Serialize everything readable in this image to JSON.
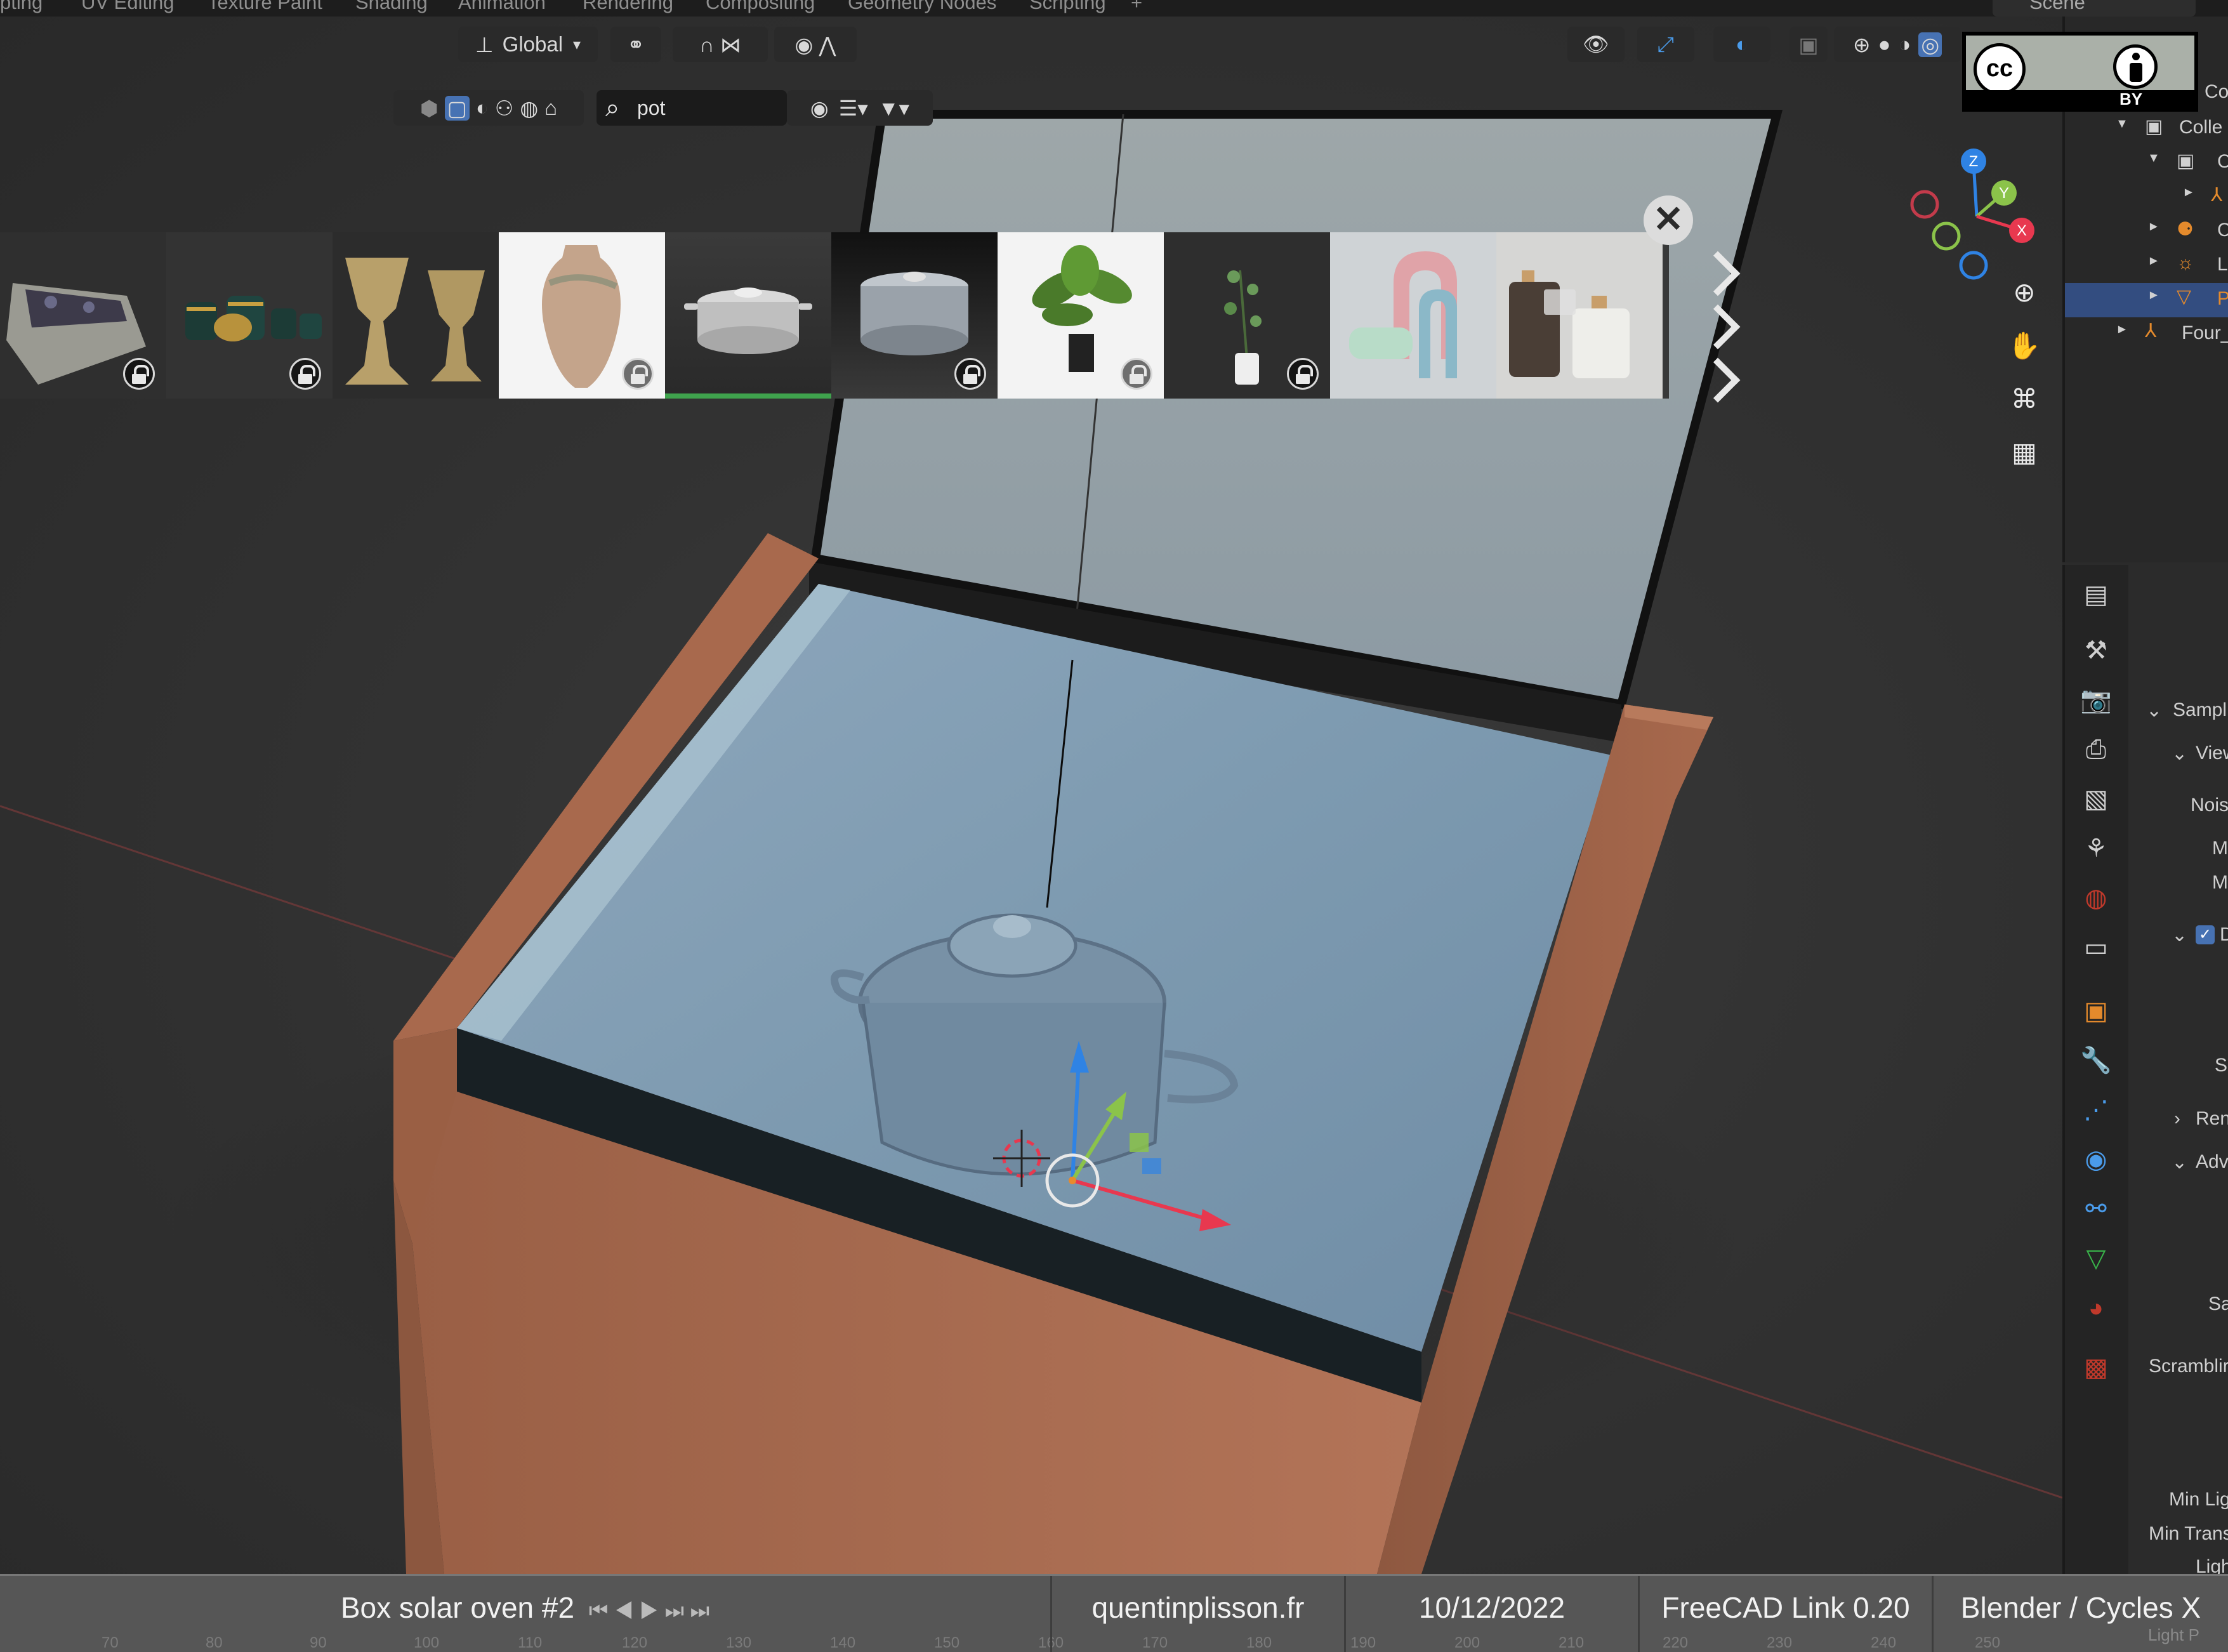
{
  "workspace_tabs": [
    "pting",
    "UV Editing",
    "Texture Paint",
    "Shading",
    "Animation",
    "Rendering",
    "Compositing",
    "Geometry Nodes",
    "Scripting",
    "+"
  ],
  "scene_name": "Scene",
  "viewport_header": {
    "transform_orientation": "Global",
    "search_value": "pot"
  },
  "asset_browser": {
    "items": [
      {
        "name": "stone-planter",
        "locked": true,
        "selected": false
      },
      {
        "name": "green-pots-set",
        "locked": true,
        "selected": false
      },
      {
        "name": "stone-urns",
        "locked": false,
        "selected": false
      },
      {
        "name": "terracotta-vase",
        "locked": true,
        "selected": false
      },
      {
        "name": "steel-pot",
        "locked": false,
        "selected": true
      },
      {
        "name": "steel-stock-pot",
        "locked": true,
        "selected": false
      },
      {
        "name": "potted-plant",
        "locked": true,
        "selected": false
      },
      {
        "name": "plant-vase",
        "locked": true,
        "selected": false
      },
      {
        "name": "pastel-arches",
        "locked": false,
        "selected": false
      },
      {
        "name": "glass-jars",
        "locked": false,
        "selected": false
      }
    ],
    "close_glyph": "✕"
  },
  "gizmo_axes": {
    "x": "X",
    "y": "Y",
    "z": "Z"
  },
  "outliner": {
    "rows": [
      {
        "label": "Col"
      },
      {
        "label": "Colle"
      },
      {
        "label": "C"
      },
      {
        "label": ""
      },
      {
        "label": "C"
      },
      {
        "label": "Li"
      },
      {
        "label": "Pl"
      },
      {
        "label": "Four_"
      }
    ]
  },
  "properties": {
    "labels": [
      "Sampli",
      "View",
      "Nois",
      "M",
      "M",
      "D",
      "S",
      "Ren",
      "Adv",
      "Sa",
      "Scramblir",
      "Min Lig",
      "Min Trans",
      "Ligh"
    ]
  },
  "license_badge": {
    "cc": "cc",
    "by": "BY"
  },
  "caption_bar": {
    "title": "Box solar oven #2",
    "website": "quentinplisson.fr",
    "date": "10/12/2022",
    "tool": "FreeCAD Link 0.20",
    "renderer": "Blender / Cycles X",
    "overlap_text": "Light P",
    "ruler_numbers": [
      "70",
      "80",
      "90",
      "100",
      "110",
      "120",
      "130",
      "140",
      "150",
      "160",
      "170",
      "180",
      "190",
      "200",
      "210",
      "220",
      "230",
      "240",
      "250"
    ]
  },
  "colors": {
    "accent_blue": "#4772b3",
    "axis_x": "#e8384f",
    "axis_y": "#8bc34a",
    "axis_z": "#2f83e4",
    "wood": "#a86a4e"
  }
}
